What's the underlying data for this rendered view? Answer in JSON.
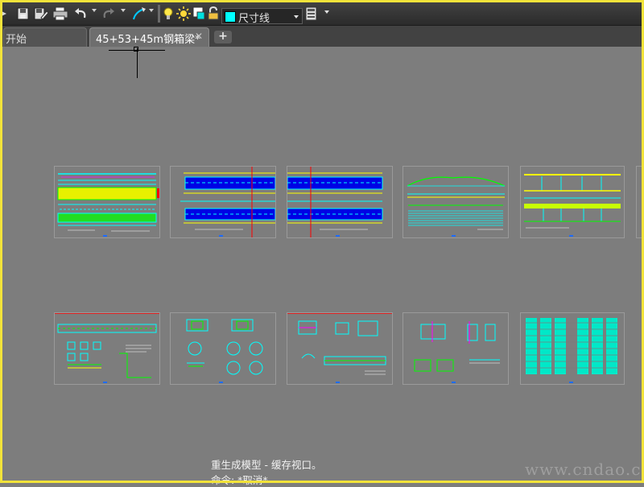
{
  "toolbar": {
    "icons": [
      "save-icon",
      "save-as-icon",
      "plot-icon",
      "undo-icon",
      "redo-icon",
      "match-properties-icon",
      "layer-on-icon",
      "layer-freeze-icon",
      "layer-color-icon",
      "layer-lock-icon"
    ],
    "layer_name": "尺寸线",
    "layer_color": "#00ffff"
  },
  "tabs": {
    "start_label": "开始",
    "drawing_label": "45+53+45m钢箱梁*",
    "close_glyph": "✕",
    "new_tab_glyph": "+"
  },
  "model_space": {
    "background": "#7d7d7d",
    "sheet_count": 11
  },
  "command": {
    "history": "重生成模型 - 缓存视口。",
    "line": "命令: *取消*"
  },
  "watermark": "www.cndao.com",
  "colors": {
    "frame": "#f2e33a",
    "cyan": "#00ffff",
    "yellow": "#ffff00",
    "green": "#00ff00",
    "blue": "#0000ff",
    "red": "#ff0000",
    "magenta": "#ff00ff"
  }
}
